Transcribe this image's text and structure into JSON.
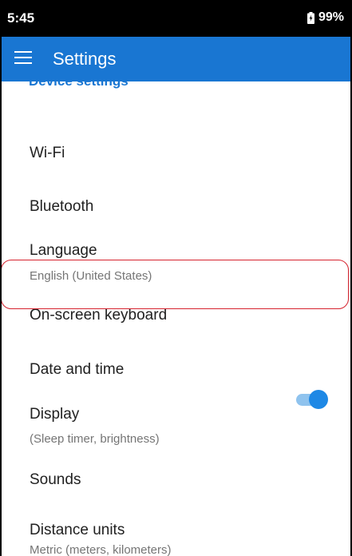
{
  "status_bar": {
    "time": "5:45",
    "battery": "99%"
  },
  "app_bar": {
    "title": "Settings"
  },
  "section_header": "Device settings",
  "items": [
    {
      "title": "Wi-Fi"
    },
    {
      "title": "Bluetooth"
    },
    {
      "title": "Language",
      "subtitle": "English (United States)"
    },
    {
      "title": "On-screen keyboard"
    },
    {
      "title": "Date and time"
    },
    {
      "title": "Display",
      "subtitle": "(Sleep timer, brightness)"
    },
    {
      "title": "Sounds",
      "toggle": true
    },
    {
      "title": "Distance units",
      "subtitle": "Metric (meters, kilometers)"
    }
  ],
  "colors": {
    "accent": "#1976d2",
    "highlight_border": "#d6232f",
    "toggle_on": "#1e88e5"
  }
}
